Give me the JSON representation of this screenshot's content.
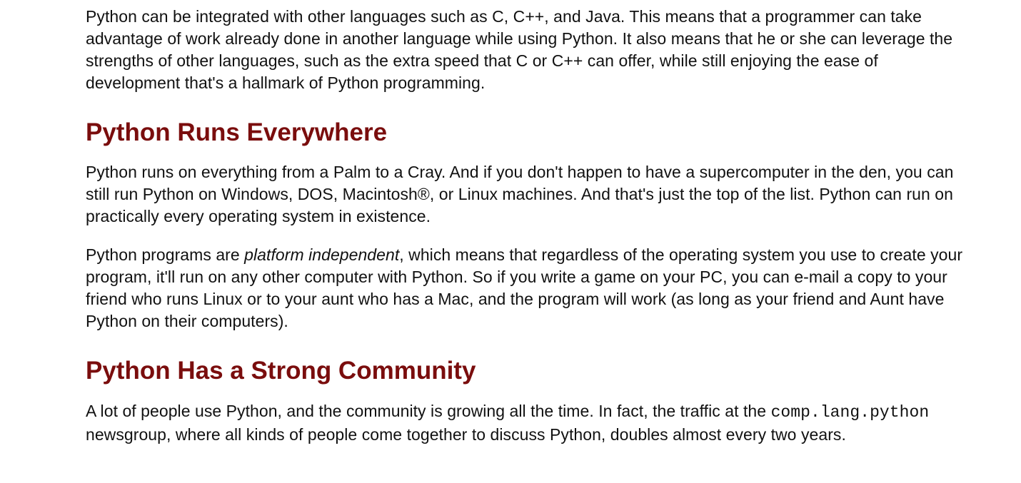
{
  "sections": {
    "intro_paragraph": "Python can be integrated with other languages such as C, C++, and Java. This means that a programmer can take advantage of work already done in another language while using Python. It also means that he or she can leverage the strengths of other languages, such as the extra speed that C or C++ can offer, while still enjoying the ease of development that's a hallmark of Python programming.",
    "runs_everywhere": {
      "heading": "Python Runs Everywhere",
      "paragraph_1": "Python runs on everything from a Palm to a Cray. And if you don't happen to have a supercomputer in the den, you can still run Python on Windows, DOS, Macintosh®, or Linux machines. And that's just the top of the list. Python can run on practically every operating system in existence.",
      "paragraph_2": {
        "before": "Python programs are ",
        "emphasis": "platform independent",
        "after": ", which means that regardless of the operating system you use to create your program, it'll run on any other computer with Python. So if you write a game on your PC, you can e-mail a copy to your friend who runs Linux or to your aunt who has a Mac, and the program will work (as long as your friend and Aunt have Python on their computers)."
      }
    },
    "community": {
      "heading": "Python Has a Strong Community",
      "paragraph": {
        "before": "A lot of people use Python, and the community is growing all the time. In fact, the traffic at the ",
        "code": "comp.lang.python",
        "after": " newsgroup, where all kinds of people come together to discuss Python, doubles almost every two years."
      }
    }
  },
  "colors": {
    "heading": "#7a0d0d",
    "text": "#111111",
    "background": "#ffffff"
  }
}
